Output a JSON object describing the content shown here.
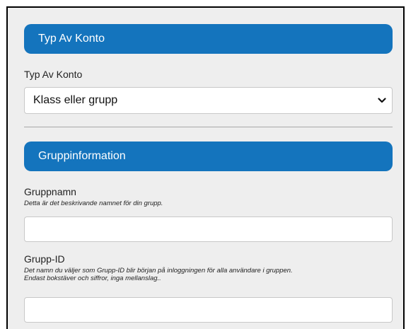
{
  "account_type": {
    "section_title": "Typ Av Konto",
    "field_label": "Typ Av Konto",
    "selected_value": "Klass eller grupp"
  },
  "group_info": {
    "section_title": "Gruppinformation",
    "group_name": {
      "label": "Gruppnamn",
      "hint": "Detta är det beskrivande namnet för din grupp.",
      "value": ""
    },
    "group_id": {
      "label": "Grupp-ID",
      "hint_line1": "Det namn du väljer som Grupp-ID blir början på inloggningen för alla användare i gruppen.",
      "hint_line2": "Endast bokstäver och siffror, inga mellanslag..",
      "value": ""
    }
  },
  "colors": {
    "header_blue": "#1474bd",
    "panel_bg": "#eeeeee"
  },
  "icons": {
    "select_arrow": "chevron-down-icon"
  }
}
